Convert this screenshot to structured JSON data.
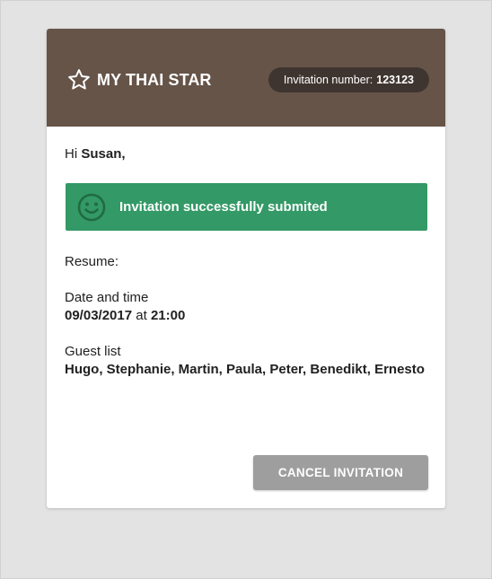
{
  "header": {
    "brand_title": "MY THAI STAR",
    "invitation_label": "Invitation number:",
    "invitation_number": "123123"
  },
  "greeting": {
    "prefix": "Hi",
    "name": "Susan,"
  },
  "success_message": "Invitation successfully submited",
  "resume": {
    "label": "Resume:",
    "date_label": "Date and time",
    "date": "09/03/2017",
    "at": "at",
    "time": "21:00",
    "guest_label": "Guest list",
    "guests": "Hugo, Stephanie, Martin, Paula, Peter, Benedikt, Ernesto"
  },
  "actions": {
    "cancel_label": "CANCEL INVITATION"
  },
  "colors": {
    "header_bg": "#665449",
    "pill_bg": "#3f3530",
    "success_bg": "#339966",
    "cancel_bg": "#9e9e9e",
    "page_bg": "#e3e3e3"
  },
  "icons": {
    "brand": "star-icon",
    "success": "smile-icon"
  }
}
